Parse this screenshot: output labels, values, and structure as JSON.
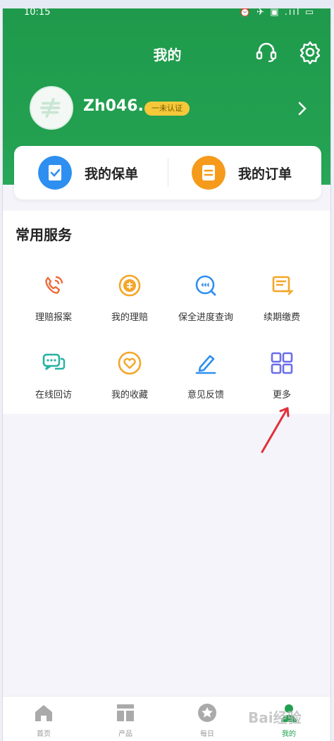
{
  "status_bar": {
    "time": "10:15",
    "icons": "⏰ ✈ ▣ .ııl ▭"
  },
  "header": {
    "title": "我的",
    "headset_icon": "headset-icon",
    "settings_icon": "gear-icon"
  },
  "profile": {
    "username": "Zh046...",
    "badge": "一未认证",
    "chevron_icon": "chevron-right-icon"
  },
  "quick_links": [
    {
      "label": "我的保单",
      "icon": "policy-icon",
      "color": "#2f8ff0"
    },
    {
      "label": "我的订单",
      "icon": "order-icon",
      "color": "#f59a1b"
    }
  ],
  "services": {
    "title": "常用服务",
    "items": [
      {
        "label": "理赔报案",
        "icon": "phone-call-icon",
        "color": "#ee6a3a"
      },
      {
        "label": "我的理赔",
        "icon": "claim-coin-icon",
        "color": "#f4a629"
      },
      {
        "label": "保全进度查询",
        "icon": "progress-search-icon",
        "color": "#2f8ff0"
      },
      {
        "label": "续期缴费",
        "icon": "renewal-payment-icon",
        "color": "#f4a629"
      },
      {
        "label": "在线回访",
        "icon": "chat-bubbles-icon",
        "color": "#26b3a3"
      },
      {
        "label": "我的收藏",
        "icon": "heart-icon",
        "color": "#f4a629"
      },
      {
        "label": "意见反馈",
        "icon": "pen-icon",
        "color": "#2f8ff0"
      },
      {
        "label": "更多",
        "icon": "grid-more-icon",
        "color": "#6a6ee8"
      }
    ]
  },
  "tabbar": [
    {
      "label": "首页",
      "icon": "home-icon"
    },
    {
      "label": "产品",
      "icon": "product-icon"
    },
    {
      "label": "每日",
      "icon": "star-icon"
    },
    {
      "label": "我的",
      "icon": "profile-icon"
    }
  ],
  "watermark": "Bai经验",
  "colors": {
    "brand_green": "#22a050",
    "badge_yellow": "#f5c83a",
    "arrow_red": "#e0303a"
  }
}
